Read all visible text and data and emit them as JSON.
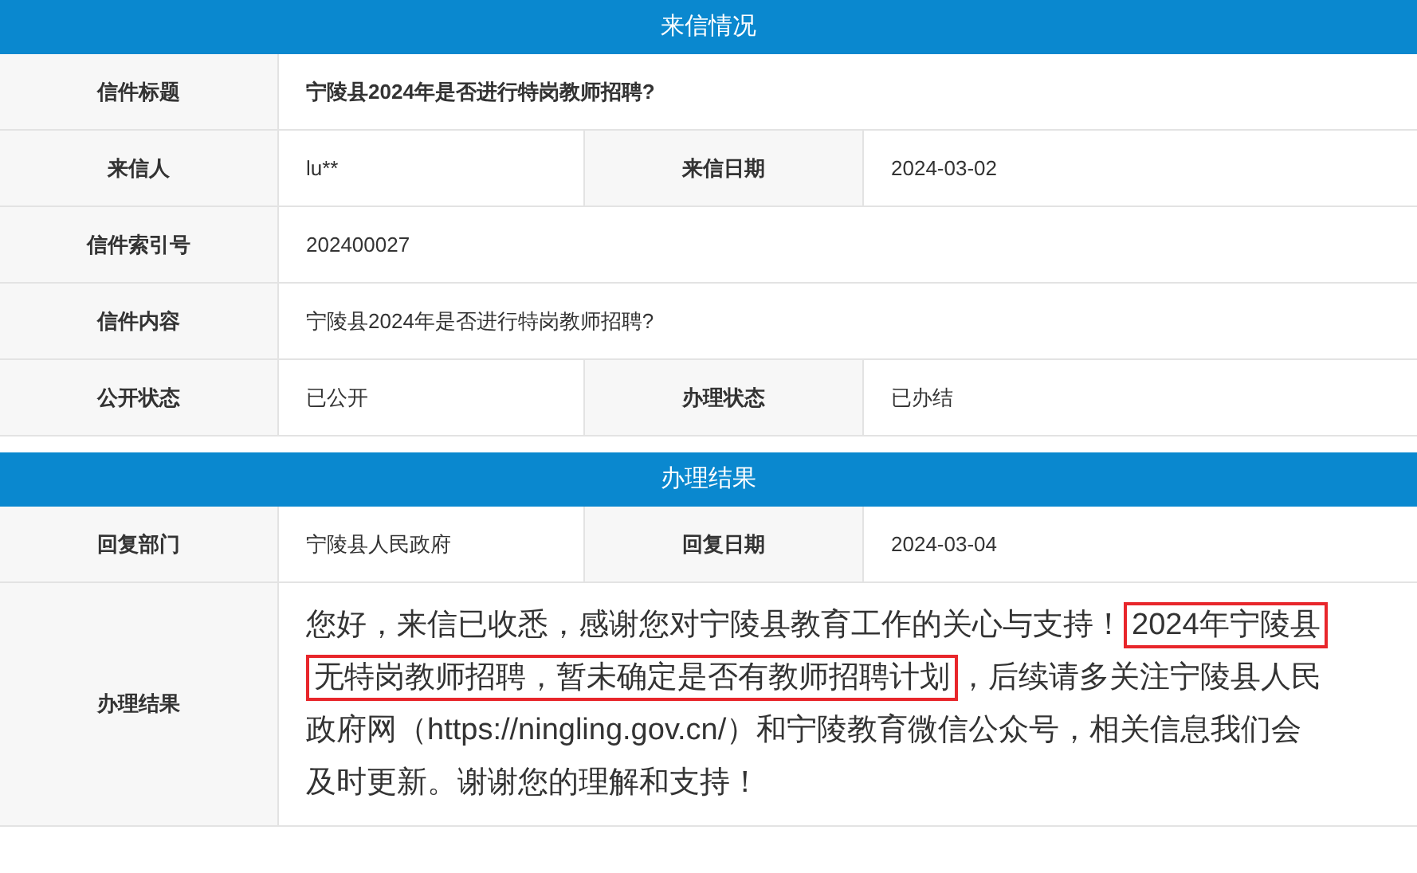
{
  "sections": [
    {
      "title": "来信情况",
      "rows": [
        {
          "fields": [
            {
              "label": "信件标题",
              "kind": "text",
              "bold": true,
              "value": "宁陵县2024年是否进行特岗教师招聘?"
            }
          ]
        },
        {
          "fields": [
            {
              "label": "来信人",
              "kind": "text",
              "bold": false,
              "value": "lu**"
            },
            {
              "label": "来信日期",
              "kind": "text",
              "bold": false,
              "value": "2024-03-02"
            }
          ]
        },
        {
          "fields": [
            {
              "label": "信件索引号",
              "kind": "text",
              "bold": false,
              "value": "202400027"
            }
          ]
        },
        {
          "fields": [
            {
              "label": "信件内容",
              "kind": "text",
              "bold": false,
              "value": "宁陵县2024年是否进行特岗教师招聘?"
            }
          ]
        },
        {
          "fields": [
            {
              "label": "公开状态",
              "kind": "text",
              "bold": false,
              "value": "已公开"
            },
            {
              "label": "办理状态",
              "kind": "text",
              "bold": false,
              "value": "已办结"
            }
          ]
        }
      ]
    },
    {
      "title": "办理结果",
      "rows": [
        {
          "fields": [
            {
              "label": "回复部门",
              "kind": "text",
              "bold": false,
              "value": "宁陵县人民政府"
            },
            {
              "label": "回复日期",
              "kind": "text",
              "bold": false,
              "value": "2024-03-04"
            }
          ]
        },
        {
          "fields": [
            {
              "label": "办理结果",
              "kind": "paragraph",
              "segments": [
                {
                  "text": "您好，来信已收悉，感谢您对宁陵县教育工作的关心与支持！",
                  "marked": false
                },
                {
                  "text": "2024年宁陵县无特岗教师招聘，暂未确定是否有教师招聘计划",
                  "marked": true
                },
                {
                  "text": "，后续请多关注宁陵县人民政府网（https://ningling.gov.cn/）和宁陵教育微信公众号，相关信息我们会及时更新。谢谢您的理解和支持！",
                  "marked": false
                }
              ]
            }
          ]
        }
      ]
    }
  ]
}
